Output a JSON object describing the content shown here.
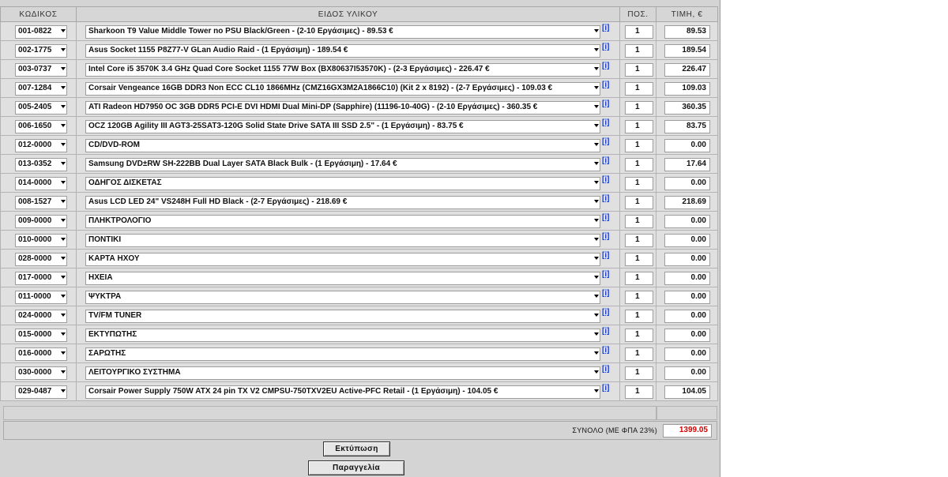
{
  "headers": {
    "code": "ΚΩΔΙΚΟΣ",
    "item": "ΕΙΔΟΣ ΥΛΙΚΟΥ",
    "qty": "ΠΟΣ.",
    "price": "ΤΙΜΗ, €"
  },
  "info_label": "[i]",
  "rows": [
    {
      "code": "001-0822",
      "item": "Sharkoon T9 Value Middle Tower no PSU Black/Green - (2-10 Εργάσιμες) - 89.53 €",
      "qty": "1",
      "price": "89.53"
    },
    {
      "code": "002-1775",
      "item": "Asus Socket 1155 P8Z77-V GLan Audio Raid - (1 Εργάσιμη) - 189.54 €",
      "qty": "1",
      "price": "189.54"
    },
    {
      "code": "003-0737",
      "item": "Intel Core i5 3570K 3.4 GHz Quad Core Socket 1155 77W Box (BX80637I53570K) - (2-3 Εργάσιμες) - 226.47 €",
      "qty": "1",
      "price": "226.47"
    },
    {
      "code": "007-1284",
      "item": "Corsair Vengeance 16GB DDR3 Non ECC CL10 1866MHz (CMZ16GX3M2A1866C10) (Kit 2 x 8192) - (2-7 Εργάσιμες) - 109.03 €",
      "qty": "1",
      "price": "109.03"
    },
    {
      "code": "005-2405",
      "item": "ATI Radeon HD7950 OC 3GB DDR5 PCI-E DVI HDMI Dual Mini-DP (Sapphire) (11196-10-40G) - (2-10 Εργάσιμες) - 360.35 €",
      "qty": "1",
      "price": "360.35"
    },
    {
      "code": "006-1650",
      "item": "OCZ 120GB Agility III AGT3-25SAT3-120G Solid State Drive SATA III SSD 2.5\" - (1 Εργάσιμη) - 83.75 €",
      "qty": "1",
      "price": "83.75"
    },
    {
      "code": "012-0000",
      "item": "CD/DVD-ROM",
      "qty": "1",
      "price": "0.00"
    },
    {
      "code": "013-0352",
      "item": "Samsung DVD±RW SH-222BB Dual Layer SATA Black Bulk - (1 Εργάσιμη) - 17.64 €",
      "qty": "1",
      "price": "17.64"
    },
    {
      "code": "014-0000",
      "item": "ΟΔΗΓΟΣ ΔΙΣΚΕΤΑΣ",
      "qty": "1",
      "price": "0.00"
    },
    {
      "code": "008-1527",
      "item": "Asus LCD LED 24\" VS248H Full HD Black - (2-7 Εργάσιμες) - 218.69 €",
      "qty": "1",
      "price": "218.69"
    },
    {
      "code": "009-0000",
      "item": "ΠΛΗΚΤΡΟΛΟΓΙΟ",
      "qty": "1",
      "price": "0.00"
    },
    {
      "code": "010-0000",
      "item": "ΠΟΝΤΙΚΙ",
      "qty": "1",
      "price": "0.00"
    },
    {
      "code": "028-0000",
      "item": "ΚΑΡΤΑ ΗΧΟΥ",
      "qty": "1",
      "price": "0.00"
    },
    {
      "code": "017-0000",
      "item": "ΗΧΕΙΑ",
      "qty": "1",
      "price": "0.00"
    },
    {
      "code": "011-0000",
      "item": "ΨΥΚΤΡΑ",
      "qty": "1",
      "price": "0.00"
    },
    {
      "code": "024-0000",
      "item": "TV/FM TUNER",
      "qty": "1",
      "price": "0.00"
    },
    {
      "code": "015-0000",
      "item": "ΕΚΤΥΠΩΤΗΣ",
      "qty": "1",
      "price": "0.00"
    },
    {
      "code": "016-0000",
      "item": "ΣΑΡΩΤΗΣ",
      "qty": "1",
      "price": "0.00"
    },
    {
      "code": "030-0000",
      "item": "ΛΕΙΤΟΥΡΓΙΚΟ ΣΥΣΤΗΜΑ",
      "qty": "1",
      "price": "0.00"
    },
    {
      "code": "029-0487",
      "item": "Corsair Power Supply 750W ATX 24 pin TX V2 CMPSU-750TXV2EU Active-PFC Retail - (1 Εργάσιμη) - 104.05 €",
      "qty": "1",
      "price": "104.05"
    }
  ],
  "total": {
    "label": "ΣΥΝΟΛΟ (ΜΕ ΦΠΑ 23%)",
    "value": "1399.05",
    "color": "#d40000"
  },
  "buttons": {
    "print": "Εκτύπωση",
    "order": "Παραγγελία"
  },
  "icons": {
    "dropdown": "chevron-down-icon",
    "info": "info-icon"
  }
}
